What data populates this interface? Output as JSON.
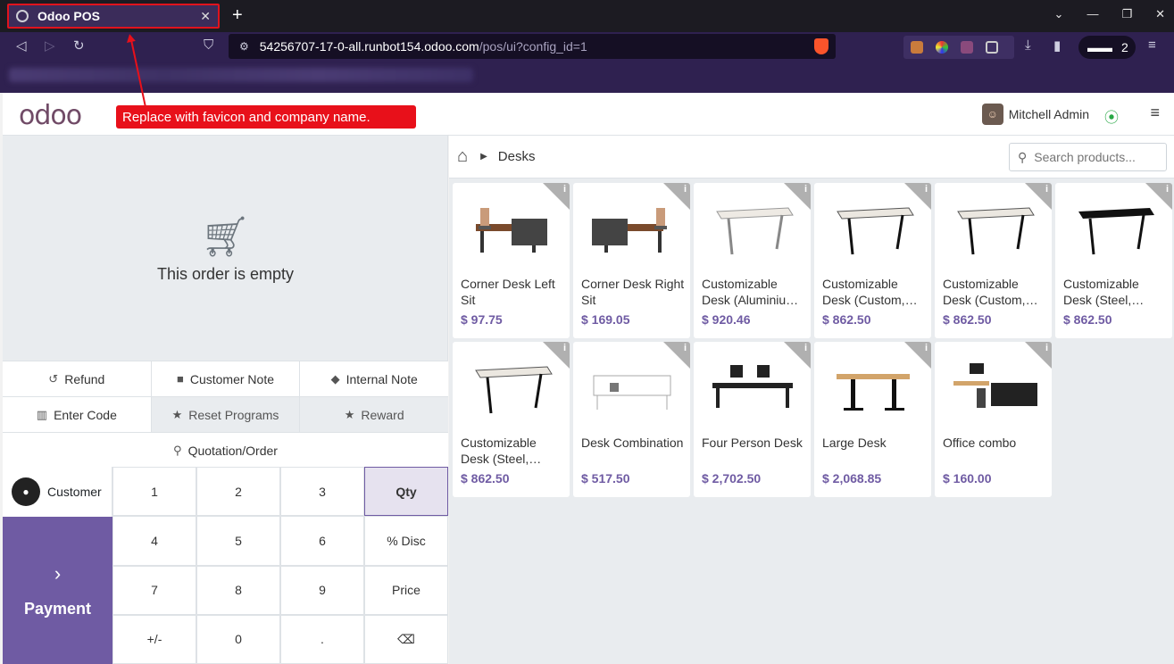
{
  "browser": {
    "tab_title": "Odoo POS",
    "tab_close": "✕",
    "new_tab": "+",
    "url_host": "54256707-17-0-all.runbot154.odoo.com",
    "url_path": "/pos/ui?config_id=1",
    "profile_count": "2"
  },
  "annotation": {
    "callout": "Replace with favicon and company name."
  },
  "header": {
    "logo": "odoo",
    "user_name": "Mitchell Admin"
  },
  "order": {
    "empty_text": "This order is empty"
  },
  "controls": {
    "refund": "Refund",
    "customer_note": "Customer Note",
    "internal_note": "Internal Note",
    "enter_code": "Enter Code",
    "reset_programs": "Reset Programs",
    "reward": "Reward",
    "quotation": "Quotation/Order"
  },
  "numpad": {
    "customer": "Customer",
    "payment": "Payment",
    "keys": [
      "1",
      "2",
      "3",
      "Qty",
      "4",
      "5",
      "6",
      "% Disc",
      "7",
      "8",
      "9",
      "Price",
      "+/-",
      "0",
      ".",
      "⌫"
    ]
  },
  "products_pane": {
    "breadcrumb": "Desks",
    "search_placeholder": "Search products...",
    "products": [
      {
        "name": "Corner Desk Left Sit",
        "price": "$ 97.75"
      },
      {
        "name": "Corner Desk Right Sit",
        "price": "$ 169.05"
      },
      {
        "name": "Customizable Desk (Aluminiu…",
        "price": "$ 920.46"
      },
      {
        "name": "Customizable Desk (Custom,…",
        "price": "$ 862.50"
      },
      {
        "name": "Customizable Desk (Custom,…",
        "price": "$ 862.50"
      },
      {
        "name": "Customizable Desk (Steel,…",
        "price": "$ 862.50"
      },
      {
        "name": "Customizable Desk (Steel,…",
        "price": "$ 862.50"
      },
      {
        "name": "Desk Combination",
        "price": "$ 517.50"
      },
      {
        "name": "Four Person Desk",
        "price": "$ 2,702.50"
      },
      {
        "name": "Large Desk",
        "price": "$ 2,068.85"
      },
      {
        "name": "Office combo",
        "price": "$ 160.00"
      }
    ]
  }
}
